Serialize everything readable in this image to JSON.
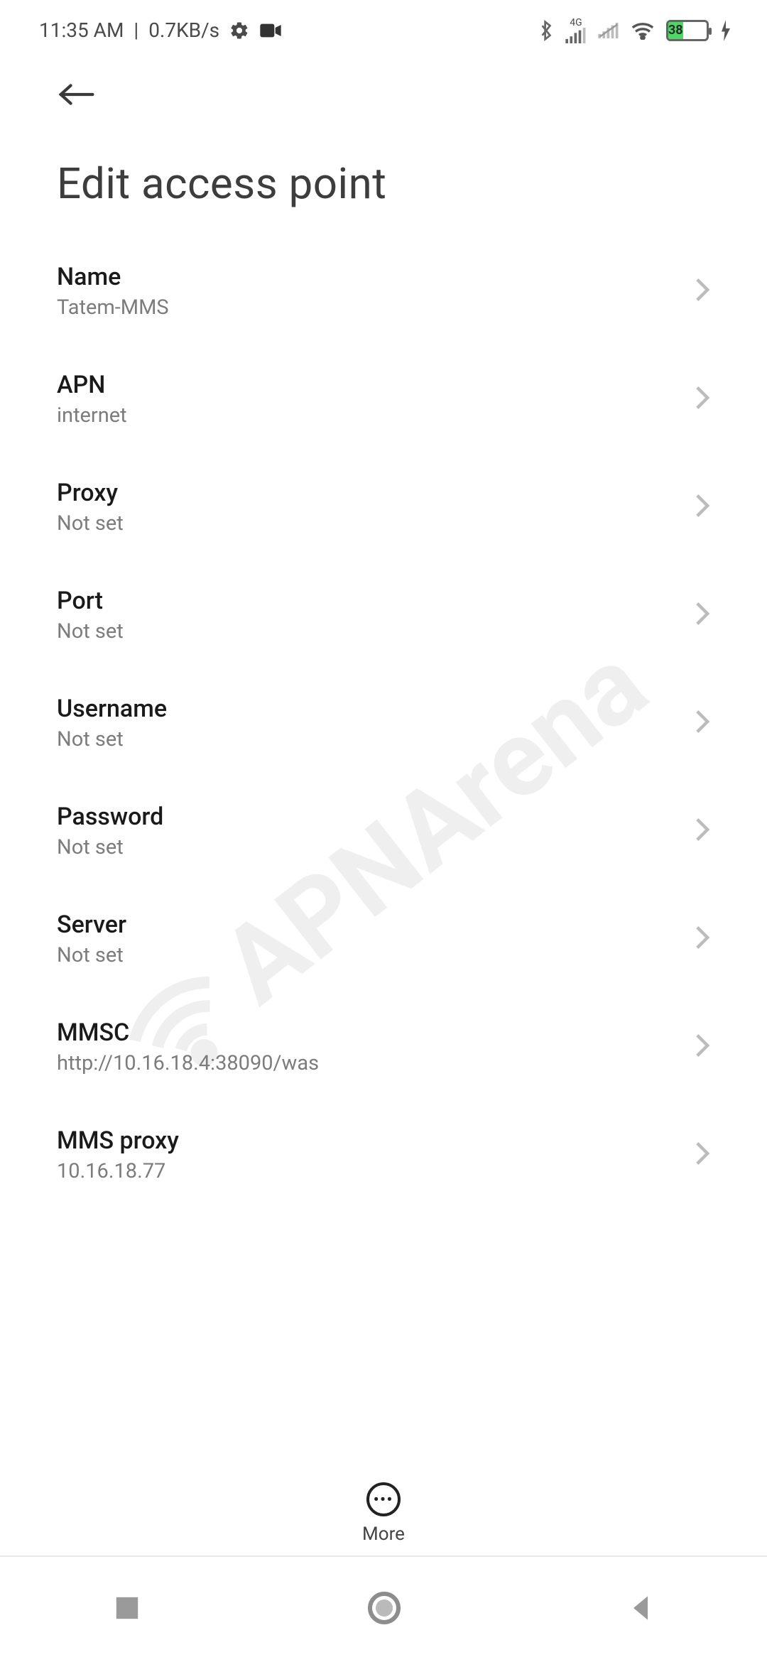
{
  "status": {
    "time": "11:35 AM",
    "speed": "0.7KB/s",
    "network_label": "4G",
    "battery_pct": "38"
  },
  "screen": {
    "title": "Edit access point"
  },
  "fields": [
    {
      "key": "name",
      "label": "Name",
      "value": "Tatem-MMS"
    },
    {
      "key": "apn",
      "label": "APN",
      "value": "internet"
    },
    {
      "key": "proxy",
      "label": "Proxy",
      "value": "Not set"
    },
    {
      "key": "port",
      "label": "Port",
      "value": "Not set"
    },
    {
      "key": "username",
      "label": "Username",
      "value": "Not set"
    },
    {
      "key": "password",
      "label": "Password",
      "value": "Not set"
    },
    {
      "key": "server",
      "label": "Server",
      "value": "Not set"
    },
    {
      "key": "mmsc",
      "label": "MMSC",
      "value": "http://10.16.18.4:38090/was"
    },
    {
      "key": "mmsproxy",
      "label": "MMS proxy",
      "value": "10.16.18.77"
    }
  ],
  "footer": {
    "more_label": "More"
  },
  "watermark": "APNArena"
}
